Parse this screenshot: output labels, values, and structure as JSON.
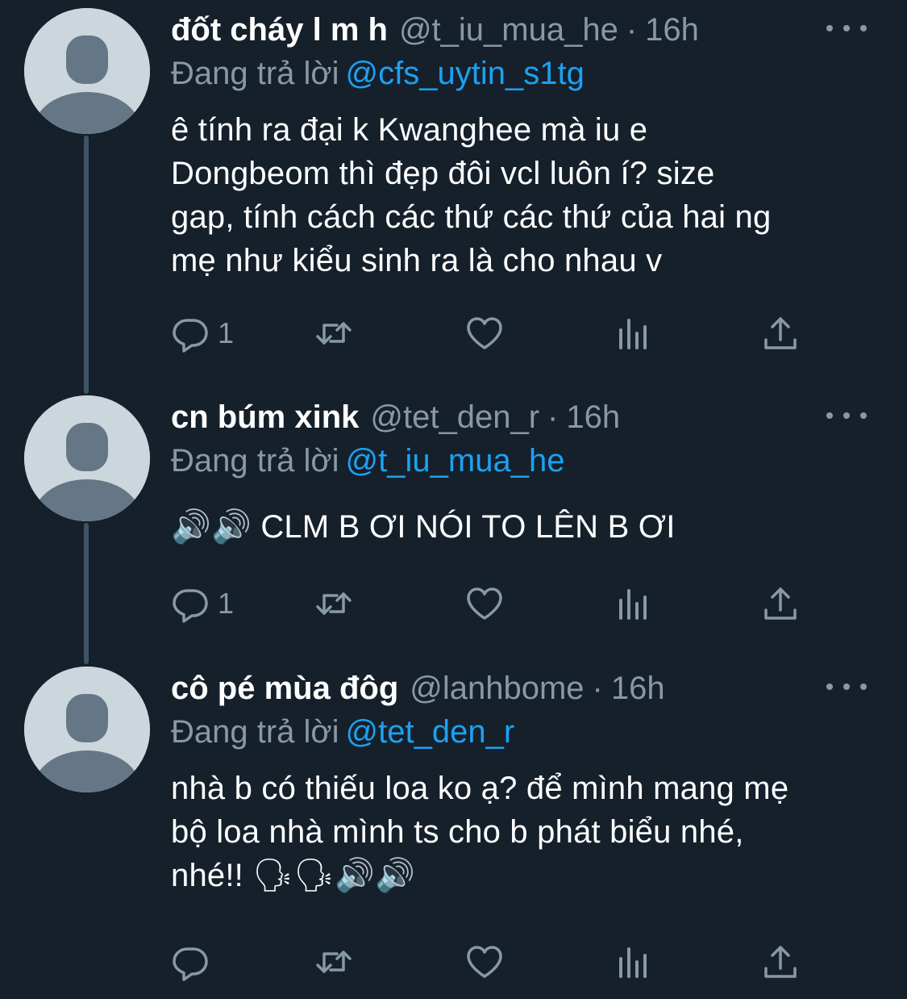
{
  "colors": {
    "background": "#15202b",
    "secondary_text": "#8899a6",
    "link": "#1da1f2",
    "avatar_bg": "#ccd6dd",
    "avatar_fg": "#657786",
    "thread_line": "#3d5466"
  },
  "tweets": [
    {
      "display_name": "đốt cháy l m h",
      "handle": "@t_iu_mua_he",
      "separator": "·",
      "time": "16h",
      "reply_prefix": "Đang trả lời",
      "reply_to": "@cfs_uytin_s1tg",
      "text": "ê tính ra đại k Kwanghee mà iu e\nDongbeom thì đẹp đôi vcl luôn í? size\ngap, tính cách các thứ các thứ của hai ng\nmẹ như kiểu sinh ra là cho nhau v",
      "reply_count": "1"
    },
    {
      "display_name": "cn búm xink",
      "handle": "@tet_den_r",
      "separator": "·",
      "time": "16h",
      "reply_prefix": "Đang trả lời",
      "reply_to": "@t_iu_mua_he",
      "text": "🔊🔊 CLM B ƠI NÓI TO LÊN B ƠI",
      "reply_count": "1"
    },
    {
      "display_name": "cô pé mùa đôg",
      "handle": "@lanhbome",
      "separator": "·",
      "time": "16h",
      "reply_prefix": "Đang trả lời",
      "reply_to": "@tet_den_r",
      "text": "nhà b có thiếu loa ko ạ? để mình mang mẹ\nbộ loa nhà mình ts cho b phát biểu nhé,\nnhé!! 🗣🗣🔊🔊",
      "reply_count": ""
    }
  ],
  "icons": [
    "reply-icon",
    "retweet-icon",
    "like-icon",
    "analytics-icon",
    "share-icon",
    "more-icon",
    "default-avatar-icon"
  ]
}
